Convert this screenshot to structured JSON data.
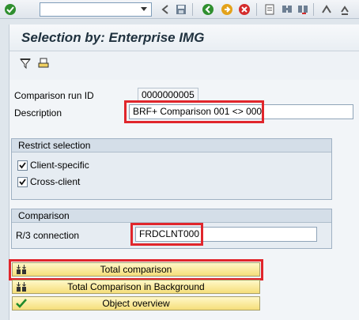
{
  "toolbar": {
    "command_value": "",
    "icons": [
      "enter-icon",
      "save-icon",
      "back-icon",
      "exit-icon",
      "cancel-icon",
      "print-icon",
      "find-icon",
      "find-next-icon",
      "first-page-icon",
      "prev-page-icon"
    ]
  },
  "page": {
    "title": "Selection by: Enterprise IMG"
  },
  "app_toolbar": {
    "icons": [
      "filter-icon",
      "print-icon"
    ]
  },
  "form": {
    "comparison_run_id_label": "Comparison run ID",
    "comparison_run_id_value": "0000000005",
    "description_label": "Description",
    "description_value": "BRF+ Comparison 001 <> 000"
  },
  "restrict_selection": {
    "title": "Restrict selection",
    "client_specific_label": "Client-specific",
    "client_specific_checked": true,
    "cross_client_label": "Cross-client",
    "cross_client_checked": true
  },
  "comparison": {
    "title": "Comparison",
    "rfc_label": "R/3 connection",
    "rfc_value": "FRDCLNT000"
  },
  "buttons": {
    "total_comparison": "Total comparison",
    "total_comparison_background": "Total Comparison in Background",
    "object_overview": "Object overview"
  },
  "colors": {
    "highlight": "#e0262c",
    "button_fill": "#f5de7a"
  }
}
